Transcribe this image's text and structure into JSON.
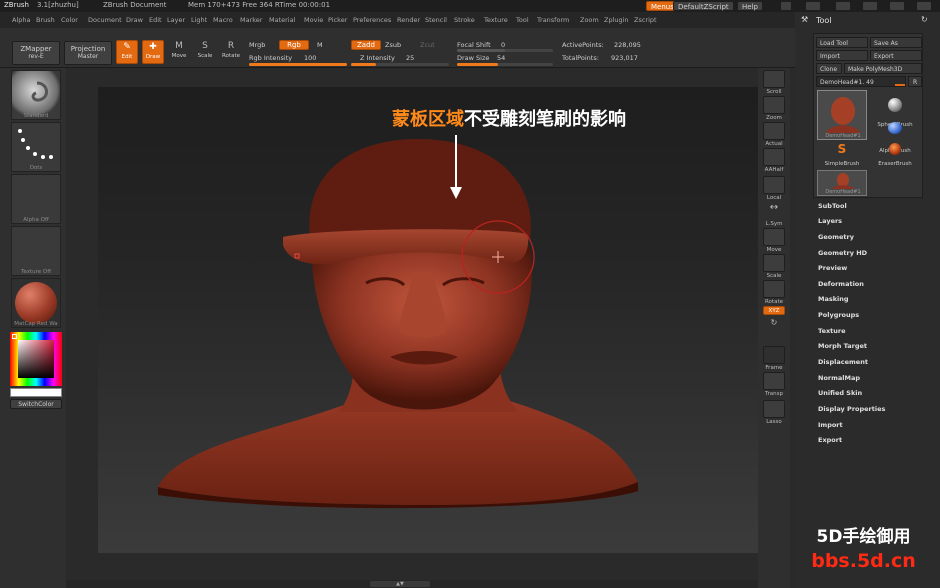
{
  "titlebar": {
    "app": "ZBrush",
    "version": "3.1[zhuzhu]",
    "document": "ZBrush Document",
    "mem": "Mem 170+473 Free 364 RTime 00:00:01",
    "menus_btn": "Menus",
    "script_btn": "DefaultZScript",
    "help_btn": "Help"
  },
  "menubar": [
    "Alpha",
    "Brush",
    "Color",
    "Document",
    "Draw",
    "Edit",
    "Layer",
    "Light",
    "Macro",
    "Marker",
    "Material",
    "Movie",
    "Picker",
    "Preferences",
    "Render",
    "Stencil",
    "Stroke",
    "Texture",
    "Tool",
    "Transform",
    "Zoom",
    "Zplugin",
    "Zscript"
  ],
  "toolbar": {
    "zmapper": "ZMapper",
    "zmapper_sub": "rev-E",
    "projection": "Projection",
    "projection_sub": "Master",
    "edit": "Edit",
    "draw": "Draw",
    "move": "Move",
    "scale": "Scale",
    "rotate": "Rotate",
    "mrgb": "Mrgb",
    "rgb": "Rgb",
    "m": "M",
    "rgb_intensity_label": "Rgb Intensity",
    "rgb_intensity": "100",
    "zadd": "Zadd",
    "zsub": "Zsub",
    "zcut": "Zcut",
    "z_intensity_label": "Z Intensity",
    "z_intensity": "25",
    "focal_shift_label": "Focal Shift",
    "focal_shift": "0",
    "draw_size_label": "Draw Size",
    "draw_size": "54",
    "active_points_label": "ActivePoints:",
    "active_points": "228,095",
    "total_points_label": "TotalPoints:",
    "total_points": "923,017"
  },
  "leftshelf": {
    "standard": "Standard",
    "dots": "Dots",
    "alpha": "Alpha  Off",
    "texture": "Texture  Off",
    "matcap": "MatCap Red Wa",
    "switchcolor": "SwitchColor"
  },
  "rightshelf": [
    "Scroll",
    "Zoom",
    "Actual",
    "AAHalf",
    "Local",
    "L.Sym",
    "Move",
    "Scale",
    "Rotate",
    "XYZ",
    "",
    "Frame",
    "Transp",
    "Lasso"
  ],
  "toolpanel": {
    "title": "Tool",
    "load_tool": "Load Tool",
    "save_as": "Save As",
    "import": "Import",
    "export": "Export",
    "clone": "Clone",
    "make_polymesh": "Make PolyMesh3D",
    "current_tool": "DemoHead#1. 49",
    "r_btn": "R",
    "thumbs": [
      "DemoHead#1",
      "SphereBrush",
      "AlphaBrush",
      "SimpleBrush",
      "EraserBrush",
      "DemoHead#1"
    ],
    "sections": [
      "SubTool",
      "Layers",
      "Geometry",
      "Geometry HD",
      "Preview",
      "Deformation",
      "Masking",
      "Polygroups",
      "Texture",
      "Morph Target",
      "Displacement",
      "NormalMap",
      "Unified Skin",
      "Display Properties",
      "Import",
      "Export"
    ]
  },
  "annotation": {
    "highlight": "蒙板区域",
    "rest": "不受雕刻笔刷的影响"
  },
  "watermark": {
    "line1": "5D手绘御用",
    "line2": "bbs.5d.cn"
  },
  "colors": {
    "accent": "#e46a12",
    "head": "#9a3a26",
    "annotation_orange": "#ff8a1a"
  }
}
